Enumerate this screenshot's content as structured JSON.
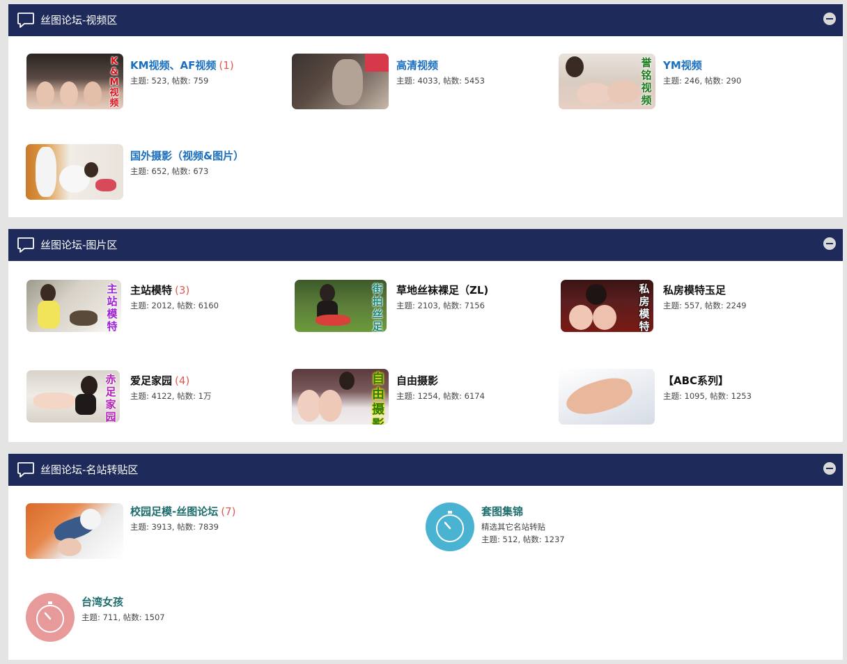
{
  "colors": {
    "header_bg": "#1e2b5a",
    "link_blue": "#1a6fbe",
    "link_teal": "#1d6d6d",
    "count_red": "#e05a4f"
  },
  "sections": [
    {
      "title": "丝图论坛-视频区",
      "forums": [
        {
          "name": "KM视频、AF视频",
          "count": "(1)",
          "stats": "主题: 523, 帖数: 759",
          "label": "K&M视频",
          "label_color": "#d8111a"
        },
        {
          "name": "高清视频",
          "count": "",
          "stats": "主题: 4033, 帖数: 5453",
          "label": "",
          "label_color": ""
        },
        {
          "name": "YM视频",
          "count": "",
          "stats": "主题: 246, 帖数: 290",
          "label": "誉铭视频",
          "label_color": "#1c7a1c"
        },
        {
          "name": "国外摄影（视频&图片）",
          "count": "",
          "stats": "主题: 652, 帖数: 673",
          "label": "",
          "label_color": ""
        }
      ]
    },
    {
      "title": "丝图论坛-图片区",
      "forums": [
        {
          "name": "主站模特",
          "count": "(3)",
          "stats": "主题: 2012, 帖数: 6160",
          "label": "主站模特",
          "label_color": "#9c1fd6"
        },
        {
          "name": "草地丝袜裸足（ZL)",
          "count": "",
          "stats": "主题: 2103, 帖数: 7156",
          "label": "街拍丝足",
          "label_color": "#1c8a7a"
        },
        {
          "name": "私房模特玉足",
          "count": "",
          "stats": "主题: 557, 帖数: 2249",
          "label": "私房模特",
          "label_color": "#ffffff"
        },
        {
          "name": "爱足家园",
          "count": "(4)",
          "stats": "主题: 4122, 帖数: 1万",
          "label": "赤足家园",
          "label_color": "#b41fb9"
        },
        {
          "name": "自由摄影",
          "count": "",
          "stats": "主题: 1254, 帖数: 6174",
          "label": "自由摄影",
          "label_color": "#2c7a12"
        },
        {
          "name": "【ABC系列】",
          "count": "",
          "stats": "主题: 1095, 帖数: 1253",
          "label": "",
          "label_color": ""
        }
      ]
    },
    {
      "title": "丝图论坛-名站转贴区",
      "forums": [
        {
          "name": "校园足模-丝图论坛",
          "count": "(7)",
          "stats": "主题: 3913, 帖数: 7839",
          "desc": ""
        },
        {
          "name": "套图集锦",
          "count": "",
          "stats": "主题: 512, 帖数: 1237",
          "desc": "精选其它名站转贴",
          "icon": "clock-icon",
          "icon_color": "#4ab3d1"
        },
        {
          "name": "台湾女孩",
          "count": "",
          "stats": "主题: 711, 帖数: 1507",
          "desc": "",
          "icon": "clock-icon",
          "icon_color": "#e89a9b"
        }
      ]
    }
  ]
}
